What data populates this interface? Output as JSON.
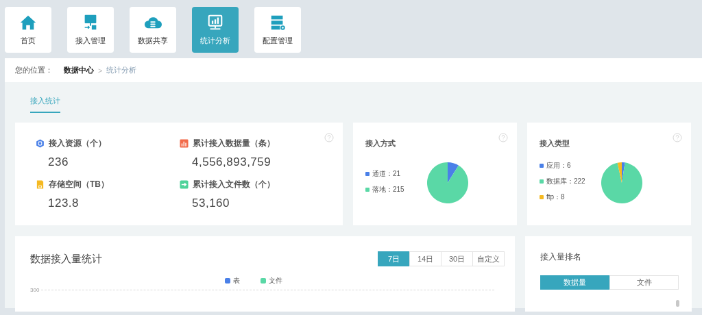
{
  "nav": [
    {
      "label": "首页",
      "selected": false
    },
    {
      "label": "接入管理",
      "selected": false
    },
    {
      "label": "数据共享",
      "selected": false
    },
    {
      "label": "统计分析",
      "selected": true
    },
    {
      "label": "配置管理",
      "selected": false
    }
  ],
  "breadcrumb": {
    "prefix": "您的位置：",
    "current": "数据中心",
    "separator": ">",
    "page": "统计分析"
  },
  "tabs": [
    {
      "label": "接入统计",
      "selected": true
    }
  ],
  "stats": [
    {
      "label": "接入资源（个）",
      "value": "236",
      "color": "#4a80e8"
    },
    {
      "label": "累计接入数据量（条）",
      "value": "4,556,893,759",
      "color": "#f26b4a"
    },
    {
      "label": "存储空间（TB）",
      "value": "123.8",
      "color": "#f5b921"
    },
    {
      "label": "累计接入文件数（个）",
      "value": "53,160",
      "color": "#4fd39a"
    }
  ],
  "pie_cards": [
    {
      "title": "接入方式",
      "separator": "：",
      "legend": [
        {
          "label": "通道",
          "value": "21",
          "color": "#4a80e8"
        },
        {
          "label": "落地",
          "value": "215",
          "color": "#5ad8a6"
        }
      ],
      "chart_data": {
        "type": "pie",
        "values": [
          8.9,
          91.1
        ]
      }
    },
    {
      "title": "接入类型",
      "separator": "：",
      "legend": [
        {
          "label": "应用",
          "value": "6",
          "color": "#4a80e8"
        },
        {
          "label": "数据库",
          "value": "222",
          "color": "#5ad8a6"
        },
        {
          "label": "ftp",
          "value": "8",
          "color": "#f5b921"
        }
      ],
      "chart_data": {
        "type": "pie",
        "values": [
          2.5,
          94.1,
          3.4
        ]
      }
    }
  ],
  "volume": {
    "title": "数据接入量统计",
    "ranges": [
      {
        "label": "7日",
        "selected": true
      },
      {
        "label": "14日",
        "selected": false
      },
      {
        "label": "30日",
        "selected": false
      },
      {
        "label": "自定义",
        "selected": false
      }
    ],
    "legend": [
      {
        "label": "表",
        "color": "#4a80e8"
      },
      {
        "label": "文件",
        "color": "#5ad8a6"
      }
    ],
    "axis_tick": "300"
  },
  "ranking": {
    "title": "接入量排名",
    "toggles": [
      {
        "label": "数据量",
        "selected": true
      },
      {
        "label": "文件",
        "selected": false
      }
    ]
  }
}
